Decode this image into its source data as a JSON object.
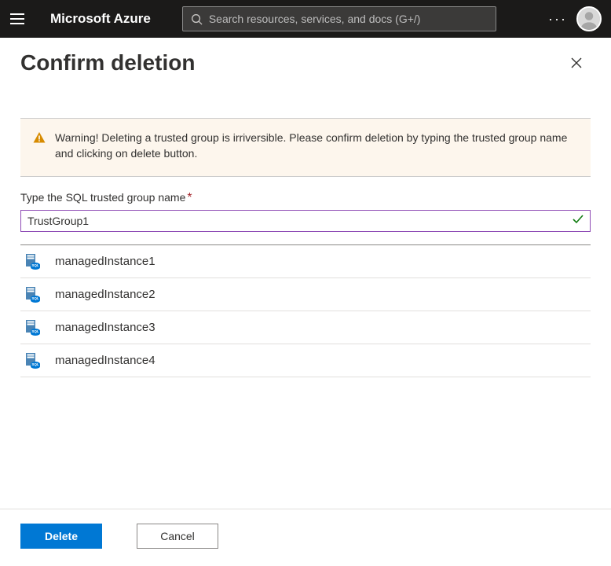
{
  "topbar": {
    "brand": "Microsoft Azure",
    "search_placeholder": "Search resources, services, and docs (G+/)"
  },
  "page": {
    "title": "Confirm deletion"
  },
  "warning": {
    "text": "Warning! Deleting a trusted group is irriversible. Please confirm deletion by typing the trusted group name and clicking on delete button."
  },
  "field": {
    "label": "Type the SQL trusted group name",
    "value": "TrustGroup1"
  },
  "instances": [
    {
      "name": "managedInstance1"
    },
    {
      "name": "managedInstance2"
    },
    {
      "name": "managedInstance3"
    },
    {
      "name": "managedInstance4"
    }
  ],
  "footer": {
    "delete_label": "Delete",
    "cancel_label": "Cancel"
  }
}
